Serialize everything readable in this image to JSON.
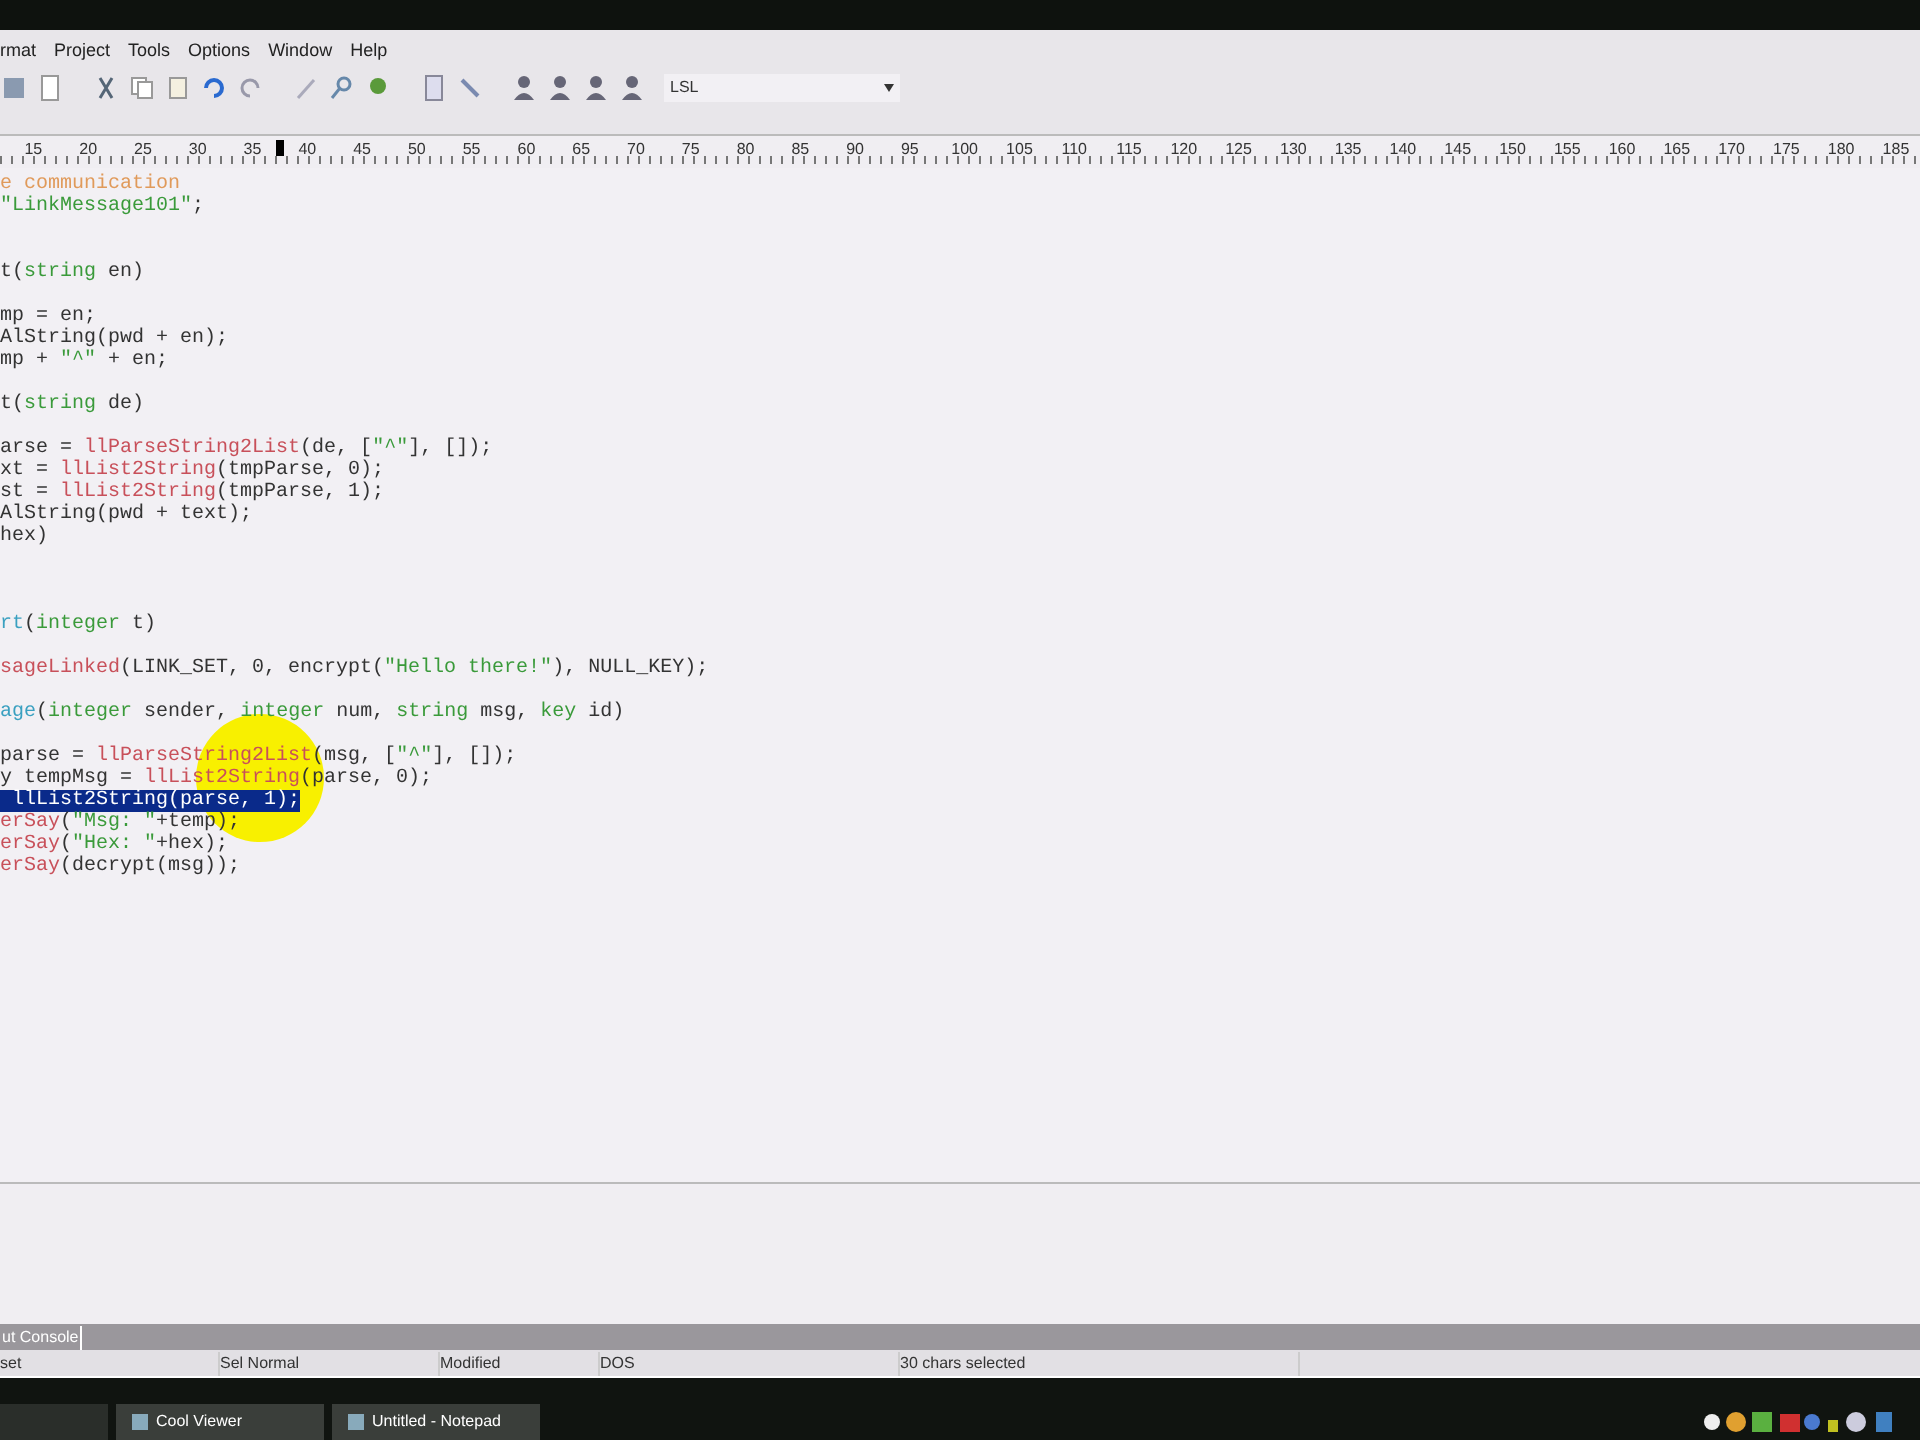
{
  "menu": [
    "rmat",
    "Project",
    "Tools",
    "Options",
    "Window",
    "Help"
  ],
  "toolbar": {
    "language": "LSL"
  },
  "ruler": [
    "15",
    "20",
    "25",
    "30",
    "35",
    "40",
    "45",
    "50",
    "55",
    "60",
    "65",
    "70",
    "75",
    "80",
    "85",
    "90",
    "95",
    "100",
    "105",
    "110",
    "115",
    "120",
    "125",
    "130",
    "135",
    "140",
    "145",
    "150",
    "155",
    "160",
    "165",
    "170",
    "175",
    "180",
    "185"
  ],
  "code_lines": [
    {
      "kind": "code",
      "segments": [
        {
          "text": "e communication",
          "kind": "comment"
        }
      ]
    },
    {
      "kind": "code",
      "segments": [
        {
          "text": "\"LinkMessage101\"",
          "kind": "string"
        },
        {
          "text": ";",
          "kind": "plain"
        }
      ]
    },
    {
      "kind": "blank"
    },
    {
      "kind": "blank"
    },
    {
      "kind": "code",
      "segments": [
        {
          "text": "t(",
          "kind": "plain"
        },
        {
          "text": "string",
          "kind": "type"
        },
        {
          "text": " en)",
          "kind": "plain"
        }
      ]
    },
    {
      "kind": "blank"
    },
    {
      "kind": "code",
      "segments": [
        {
          "text": "mp = en;",
          "kind": "plain"
        }
      ]
    },
    {
      "kind": "code",
      "segments": [
        {
          "text": "AlString(pwd + en);",
          "kind": "plain"
        }
      ]
    },
    {
      "kind": "code",
      "segments": [
        {
          "text": "mp + ",
          "kind": "plain"
        },
        {
          "text": "\"^\"",
          "kind": "string"
        },
        {
          "text": " + en;",
          "kind": "plain"
        }
      ]
    },
    {
      "kind": "blank"
    },
    {
      "kind": "code",
      "segments": [
        {
          "text": "t(",
          "kind": "plain"
        },
        {
          "text": "string",
          "kind": "type"
        },
        {
          "text": " de)",
          "kind": "plain"
        }
      ]
    },
    {
      "kind": "blank"
    },
    {
      "kind": "code",
      "segments": [
        {
          "text": "arse = ",
          "kind": "plain"
        },
        {
          "text": "llParseString2List",
          "kind": "func"
        },
        {
          "text": "(de, [",
          "kind": "plain"
        },
        {
          "text": "\"^\"",
          "kind": "string"
        },
        {
          "text": "], []);",
          "kind": "plain"
        }
      ]
    },
    {
      "kind": "code",
      "segments": [
        {
          "text": "xt = ",
          "kind": "plain"
        },
        {
          "text": "llList2String",
          "kind": "func"
        },
        {
          "text": "(tmpParse, 0);",
          "kind": "plain"
        }
      ]
    },
    {
      "kind": "code",
      "segments": [
        {
          "text": "st = ",
          "kind": "plain"
        },
        {
          "text": "llList2String",
          "kind": "func"
        },
        {
          "text": "(tmpParse, 1);",
          "kind": "plain"
        }
      ]
    },
    {
      "kind": "code",
      "segments": [
        {
          "text": "AlString(pwd + text);",
          "kind": "plain"
        }
      ]
    },
    {
      "kind": "code",
      "segments": [
        {
          "text": "hex)",
          "kind": "plain"
        }
      ]
    },
    {
      "kind": "blank"
    },
    {
      "kind": "blank"
    },
    {
      "kind": "blank"
    },
    {
      "kind": "code",
      "segments": [
        {
          "text": "rt",
          "kind": "event"
        },
        {
          "text": "(",
          "kind": "plain"
        },
        {
          "text": "integer",
          "kind": "type"
        },
        {
          "text": " t)",
          "kind": "plain"
        }
      ]
    },
    {
      "kind": "blank"
    },
    {
      "kind": "code",
      "segments": [
        {
          "text": "sageLinked",
          "kind": "func"
        },
        {
          "text": "(LINK_SET, 0, encrypt(",
          "kind": "plain"
        },
        {
          "text": "\"Hello there!\"",
          "kind": "string"
        },
        {
          "text": "), NULL_KEY);",
          "kind": "plain"
        }
      ]
    },
    {
      "kind": "blank"
    },
    {
      "kind": "code",
      "segments": [
        {
          "text": "age",
          "kind": "event"
        },
        {
          "text": "(",
          "kind": "plain"
        },
        {
          "text": "integer",
          "kind": "type"
        },
        {
          "text": " sender, ",
          "kind": "plain"
        },
        {
          "text": "integer",
          "kind": "type"
        },
        {
          "text": " num, ",
          "kind": "plain"
        },
        {
          "text": "string",
          "kind": "type"
        },
        {
          "text": " msg, ",
          "kind": "plain"
        },
        {
          "text": "key",
          "kind": "type"
        },
        {
          "text": " id)",
          "kind": "plain"
        }
      ]
    },
    {
      "kind": "blank"
    },
    {
      "kind": "code",
      "segments": [
        {
          "text": "parse = ",
          "kind": "plain"
        },
        {
          "text": "llParseString2List",
          "kind": "func"
        },
        {
          "text": "(msg, [",
          "kind": "plain"
        },
        {
          "text": "\"^\"",
          "kind": "string"
        },
        {
          "text": "], []);",
          "kind": "plain"
        }
      ]
    },
    {
      "kind": "code",
      "segments": [
        {
          "text": "y tempMsg = ",
          "kind": "plain"
        },
        {
          "text": "llList2String",
          "kind": "func"
        },
        {
          "text": "(parse, 0);",
          "kind": "plain"
        }
      ]
    },
    {
      "kind": "code",
      "segments": [
        {
          "text": " llList2String(parse, 1);",
          "kind": "selection"
        }
      ]
    },
    {
      "kind": "code",
      "segments": [
        {
          "text": "erSay",
          "kind": "func"
        },
        {
          "text": "(",
          "kind": "plain"
        },
        {
          "text": "\"Msg: \"",
          "kind": "string"
        },
        {
          "text": "+temp);",
          "kind": "plain"
        }
      ]
    },
    {
      "kind": "code",
      "segments": [
        {
          "text": "erSay",
          "kind": "func"
        },
        {
          "text": "(",
          "kind": "plain"
        },
        {
          "text": "\"Hex: \"",
          "kind": "string"
        },
        {
          "text": "+hex);",
          "kind": "plain"
        }
      ]
    },
    {
      "kind": "code",
      "segments": [
        {
          "text": "erSay",
          "kind": "func"
        },
        {
          "text": "(decrypt(msg));",
          "kind": "plain"
        }
      ]
    }
  ],
  "output_tabs": [
    {
      "label": "ut Console",
      "selected": true
    }
  ],
  "status_bar": [
    "set",
    "Sel Normal",
    "Modified",
    "DOS",
    "30 chars selected"
  ],
  "taskbar": [
    {
      "label": "Cool Viewer",
      "selected": false
    },
    {
      "label": "Untitled - Notepad",
      "selected": false
    }
  ]
}
